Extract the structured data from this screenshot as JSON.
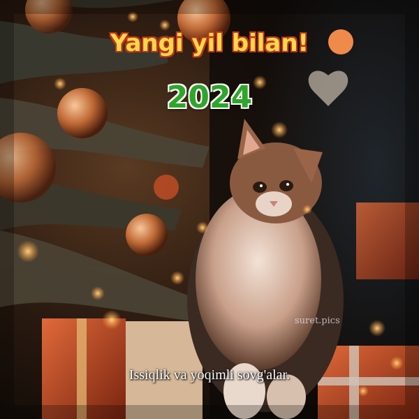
{
  "greeting": "Yangi yil bilan!",
  "year": "2024",
  "caption": "Issiqlik va yoqimli sovg'alar.",
  "watermark": "suret.pics",
  "colors": {
    "greeting_fill": "#ffd94a",
    "greeting_outline": "#c0351a",
    "year_fill": "#2ea62a",
    "year_outline": "#ffffff",
    "caption": "#ffffff"
  }
}
